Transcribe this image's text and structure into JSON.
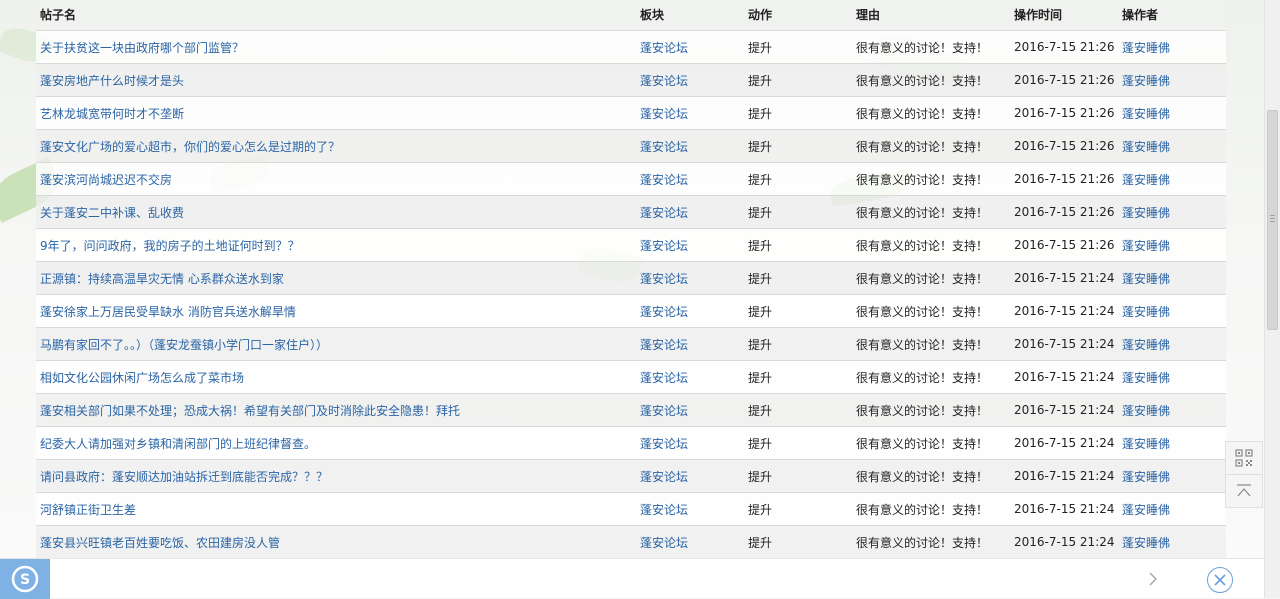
{
  "table": {
    "headers": [
      "帖子名",
      "板块",
      "动作",
      "理由",
      "操作时间",
      "操作者"
    ],
    "rows": [
      {
        "title": "关于扶贫这一块由政府哪个部门监管？",
        "forum": "蓬安论坛",
        "action": "提升",
        "reason": "很有意义的讨论！支持！",
        "time": "2016-7-15 21:26",
        "operator": "蓬安睡佛"
      },
      {
        "title": "蓬安房地产什么时候才是头",
        "forum": "蓬安论坛",
        "action": "提升",
        "reason": "很有意义的讨论！支持！",
        "time": "2016-7-15 21:26",
        "operator": "蓬安睡佛"
      },
      {
        "title": "艺林龙城宽带何时才不垄断",
        "forum": "蓬安论坛",
        "action": "提升",
        "reason": "很有意义的讨论！支持！",
        "time": "2016-7-15 21:26",
        "operator": "蓬安睡佛"
      },
      {
        "title": "蓬安文化广场的爱心超市，你们的爱心怎么是过期的了？",
        "forum": "蓬安论坛",
        "action": "提升",
        "reason": "很有意义的讨论！支持！",
        "time": "2016-7-15 21:26",
        "operator": "蓬安睡佛"
      },
      {
        "title": "蓬安滨河尚城迟迟不交房",
        "forum": "蓬安论坛",
        "action": "提升",
        "reason": "很有意义的讨论！支持！",
        "time": "2016-7-15 21:26",
        "operator": "蓬安睡佛"
      },
      {
        "title": "关于蓬安二中补课、乱收费",
        "forum": "蓬安论坛",
        "action": "提升",
        "reason": "很有意义的讨论！支持！",
        "time": "2016-7-15 21:26",
        "operator": "蓬安睡佛"
      },
      {
        "title": "9年了，问问政府，我的房子的土地证何时到？？",
        "forum": "蓬安论坛",
        "action": "提升",
        "reason": "很有意义的讨论！支持！",
        "time": "2016-7-15 21:26",
        "operator": "蓬安睡佛"
      },
      {
        "title": "正源镇：持续高温旱灾无情 心系群众送水到家",
        "forum": "蓬安论坛",
        "action": "提升",
        "reason": "很有意义的讨论！支持！",
        "time": "2016-7-15 21:24",
        "operator": "蓬安睡佛"
      },
      {
        "title": "蓬安徐家上万居民受旱缺水 消防官兵送水解旱情",
        "forum": "蓬安论坛",
        "action": "提升",
        "reason": "很有意义的讨论！支持！",
        "time": "2016-7-15 21:24",
        "operator": "蓬安睡佛"
      },
      {
        "title": "马鹏有家回不了。。）（蓬安龙蚕镇小学门口一家住户））",
        "forum": "蓬安论坛",
        "action": "提升",
        "reason": "很有意义的讨论！支持！",
        "time": "2016-7-15 21:24",
        "operator": "蓬安睡佛"
      },
      {
        "title": "相如文化公园休闲广场怎么成了菜市场",
        "forum": "蓬安论坛",
        "action": "提升",
        "reason": "很有意义的讨论！支持！",
        "time": "2016-7-15 21:24",
        "operator": "蓬安睡佛"
      },
      {
        "title": "蓬安相关部门如果不处理；恐成大祸！希望有关部门及时消除此安全隐患！拜托",
        "forum": "蓬安论坛",
        "action": "提升",
        "reason": "很有意义的讨论！支持！",
        "time": "2016-7-15 21:24",
        "operator": "蓬安睡佛"
      },
      {
        "title": "纪委大人请加强对乡镇和清闲部门的上班纪律督查。",
        "forum": "蓬安论坛",
        "action": "提升",
        "reason": "很有意义的讨论！支持！",
        "time": "2016-7-15 21:24",
        "operator": "蓬安睡佛"
      },
      {
        "title": "请问县政府：蓬安顺达加油站拆迁到底能否完成？？？",
        "forum": "蓬安论坛",
        "action": "提升",
        "reason": "很有意义的讨论！支持！",
        "time": "2016-7-15 21:24",
        "operator": "蓬安睡佛"
      },
      {
        "title": "河舒镇正街卫生差",
        "forum": "蓬安论坛",
        "action": "提升",
        "reason": "很有意义的讨论！支持！",
        "time": "2016-7-15 21:24",
        "operator": "蓬安睡佛"
      },
      {
        "title": "蓬安县兴旺镇老百姓要吃饭、农田建房没人管",
        "forum": "蓬安论坛",
        "action": "提升",
        "reason": "很有意义的讨论！支持！",
        "time": "2016-7-15 21:24",
        "operator": "蓬安睡佛"
      }
    ]
  },
  "colors": {
    "link": "#2a64a5",
    "logo_bg": "#7fb1e4"
  },
  "icons": {
    "qr": "qr-code-icon",
    "top": "back-to-top-icon",
    "logo": "sogou-logo-icon",
    "next": "chevron-right-icon",
    "close": "close-icon"
  }
}
